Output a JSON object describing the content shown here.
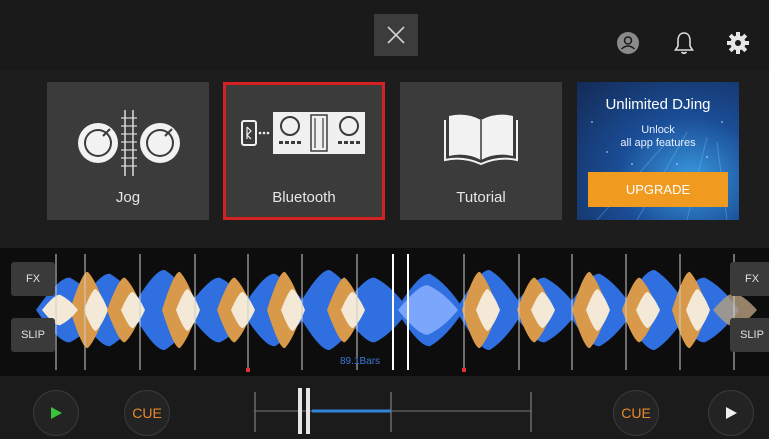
{
  "top_bar": {
    "close_icon": "close-icon",
    "profile_icon": "profile-icon",
    "bell_icon": "bell-icon",
    "settings_icon": "gear-icon"
  },
  "menu": {
    "tiles": [
      {
        "label": "Jog",
        "icon": "jog-wheels-icon",
        "selected": false
      },
      {
        "label": "Bluetooth",
        "icon": "bluetooth-controller-icon",
        "selected": true
      },
      {
        "label": "Tutorial",
        "icon": "book-icon",
        "selected": false
      }
    ],
    "promo": {
      "title": "Unlimited DJing",
      "subtitle_line1": "Unlock",
      "subtitle_line2": "all app features",
      "button_label": "UPGRADE"
    },
    "selected_border_color": "#d42222"
  },
  "waveform": {
    "left_fx": "FX",
    "left_slip": "SLIP",
    "right_fx": "FX",
    "right_slip": "SLIP",
    "bars_label": "89.1Bars",
    "colors": {
      "blue": "#2f6fe0",
      "orange": "#d89a4a",
      "cream": "#f3e9d6"
    }
  },
  "transport": {
    "left_play_icon": "play-icon",
    "left_cue": "CUE",
    "right_cue": "CUE",
    "right_play_icon": "play-icon"
  }
}
